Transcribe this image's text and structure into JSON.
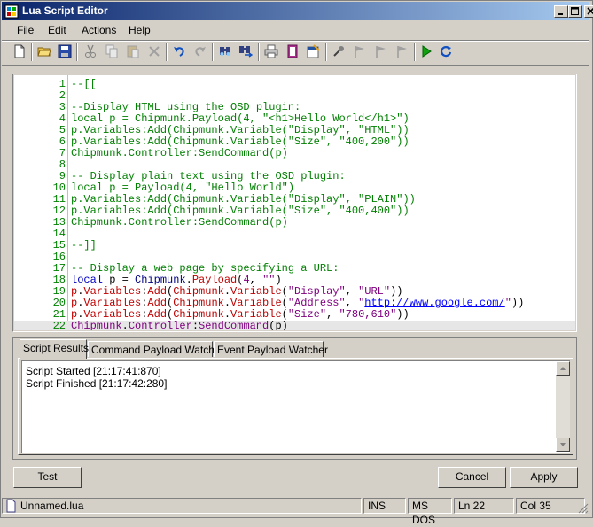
{
  "window": {
    "title": "Lua Script Editor"
  },
  "menu": {
    "items": [
      "File",
      "Edit",
      "Actions",
      "Help"
    ]
  },
  "toolbar": {
    "icons": [
      "new-file-icon",
      "open-folder-icon",
      "save-icon",
      "cut-icon",
      "copy-icon",
      "paste-icon",
      "delete-icon",
      "undo-icon",
      "redo-icon",
      "find-icon",
      "find-replace-icon",
      "print-icon",
      "book-icon",
      "properties-icon",
      "breakpoint-icon",
      "flag-icon",
      "flag-next-icon",
      "flag-prev-icon",
      "run-icon",
      "refresh-icon"
    ]
  },
  "editor": {
    "lines": [
      {
        "n": "1",
        "t": "--[["
      },
      {
        "n": "2",
        "t": ""
      },
      {
        "n": "3",
        "t": "--Display HTML using the OSD plugin:"
      },
      {
        "n": "4",
        "t": "local p = Chipmunk.Payload(4, \"<h1>Hello World</h1>\")"
      },
      {
        "n": "5",
        "t": "p.Variables:Add(Chipmunk.Variable(\"Display\", \"HTML\"))"
      },
      {
        "n": "6",
        "t": "p.Variables:Add(Chipmunk.Variable(\"Size\", \"400,200\"))"
      },
      {
        "n": "7",
        "t": "Chipmunk.Controller:SendCommand(p)"
      },
      {
        "n": "8",
        "t": ""
      },
      {
        "n": "9",
        "t": "-- Display plain text using the OSD plugin:"
      },
      {
        "n": "10",
        "t": "local p = Payload(4, \"Hello World\")"
      },
      {
        "n": "11",
        "t": "p.Variables:Add(Chipmunk.Variable(\"Display\", \"PLAIN\"))"
      },
      {
        "n": "12",
        "t": "p.Variables:Add(Chipmunk.Variable(\"Size\", \"400,400\"))"
      },
      {
        "n": "13",
        "t": "Chipmunk.Controller:SendCommand(p)"
      },
      {
        "n": "14",
        "t": ""
      },
      {
        "n": "15",
        "t": "--]]"
      },
      {
        "n": "16",
        "t": ""
      },
      {
        "n": "17",
        "t": "-- Display a web page by specifying a URL:"
      }
    ],
    "code_lines": {
      "l18": {
        "n": "18",
        "kw": "local",
        "v": " p = ",
        "cls": "Chipmunk",
        "dot": ".",
        "fn": "Payload",
        "p1": "(",
        "num": "4",
        "p2": ", ",
        "s": "\"\"",
        "end": ")"
      },
      "l19": {
        "n": "19",
        "a": "p",
        "b": ".",
        "c": "Variables",
        "d": ":",
        "e": "Add",
        "f": "(",
        "g": "Chipmunk",
        "h": ".",
        "i": "Variable",
        "j": "(",
        "s1": "\"Display\"",
        "k": ", ",
        "s2": "\"URL\"",
        "z": "))"
      },
      "l20": {
        "n": "20",
        "a": "p",
        "b": ".",
        "c": "Variables",
        "d": ":",
        "e": "Add",
        "f": "(",
        "g": "Chipmunk",
        "h": ".",
        "i": "Variable",
        "j": "(",
        "s1": "\"Address\"",
        "k": ", ",
        "q1": "\"",
        "url": "http://www.google.com/",
        "q2": "\"",
        "z": "))"
      },
      "l21": {
        "n": "21",
        "a": "p",
        "b": ".",
        "c": "Variables",
        "d": ":",
        "e": "Add",
        "f": "(",
        "g": "Chipmunk",
        "h": ".",
        "i": "Variable",
        "j": "(",
        "s1": "\"Size\"",
        "k": ", ",
        "s2": "\"780,610\"",
        "z": "))"
      },
      "l22": {
        "n": "22",
        "a": "Chipmunk",
        "b": ".",
        "c": "Controller",
        "d": ":",
        "e": "SendCommand",
        "f": "(p)"
      }
    }
  },
  "panel": {
    "tabs": [
      "Script Results",
      "Command Payload Watcher",
      "Event Payload Watcher"
    ],
    "results": [
      "Script Started [21:17:41:870]",
      "Script Finished [21:17:42:280]"
    ]
  },
  "buttons": {
    "test": "Test",
    "cancel": "Cancel",
    "apply": "Apply"
  },
  "status": {
    "file": "Unnamed.lua",
    "mode": "INS",
    "eol": "MS DOS",
    "line": "Ln 22",
    "col": "Col 35"
  },
  "colors": {
    "title_start": "#0a246a",
    "title_end": "#a6caf0",
    "comment": "#008000",
    "keyword": "#0000c0",
    "string": "#c00000",
    "number": "#800080"
  }
}
